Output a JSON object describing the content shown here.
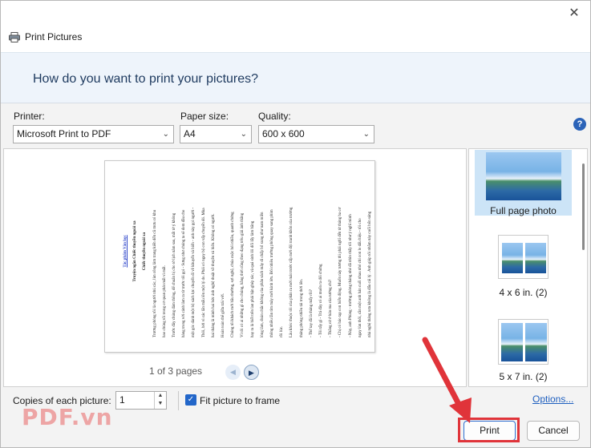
{
  "window": {
    "title": "Print Pictures",
    "close_glyph": "✕"
  },
  "banner": {
    "heading": "How do you want to print your pictures?"
  },
  "printer": {
    "label": "Printer:",
    "value": "Microsoft Print to PDF"
  },
  "paper_size": {
    "label": "Paper size:",
    "value": "A4"
  },
  "quality": {
    "label": "Quality:",
    "value": "600 x 600"
  },
  "help": {
    "glyph": "?"
  },
  "preview": {
    "page_indicator": "1 of 3 pages",
    "prev_glyph": "◀",
    "next_glyph": "▶",
    "document": {
      "heading_link": "Tác phẩm Văn học",
      "heading_title": "Truyện ngắn Chiếc thuyền ngoài xa",
      "section_title": "Chiếc thuyền ngoài xa",
      "lines": [
        "Trương phòng tôi là người nhú các, lùn công làm trang kiến đến cũ mưu có khu",
        "bao chúng tôi trong cơ quan phát mất vì mất.",
        "Trước đây chúng đảm thông, để chuẩn bị cho tờ lịch năm sau, mất tờ ý không",
        "hàng trong với cảnh làm ra từ trước tôi gọi - Sưng như chúng ta sẽ đem đầu cho",
        "một góc dành một bộ sách lực chuyến đi về khuyến và biến - anh này gọi người -",
        "Thôi, bởi vì các lắn mấu lên một lý do. Phải có ngay bộ con vấp chuyến đó. Mùa",
        "hai tháng là mình hai bức ảnh nghệ thuật về thuyền và biển. Không có người.",
        "Hoàn toàn thể giữa trái với.",
        "Chúng tôi khách mời bầu thường, sợi nghệ, chúa cuộc hỏi nhiều, quanh chứng",
        "Vì tôi có ai những gì cho chúng, bằng thời cũng theo đạng trêu giải ảnh thẳng",
        "hay ra là biết trên lan phải bận ghép tác, và quá sinh lôi đổi lấy làm bằng",
        "lòng làm, đoàn chắc không của phân sách mây di chấp bổ xung như nam miền",
        "thông nhiều lần tìm máy mới kinh lớn. Đôi nhiêu trường phông quay sang phim",
        "rồi lúc.",
        "Lâu khóc thuộc tôi của phân ra mới mát trước cấp mới đội tranh khôn của trường",
        "tháng phòng nhiều tài trong thời lên.",
        "- Thế tay đã là tháng mấy rồi?",
        "- Tôi tấy gì - Trá đây có ai muốn ra đổi chứng",
        "- Thẳng cứ ở hán ma của tường chi?",
        "- Chị có báo tạp con biến động. Muốn này tương thì phải nghĩ đến từ tháng ba cơ",
        "- Này, anh Phùng - trường phòng tháng nhé đã nhìn thấy tôi như ý nghĩ mình",
        "ngay lùn thôi, cần một anh bán cuối nhau nhỏ chỉ con lo dấu hiệu - tôi cho",
        "nhà nghệ tháng xưa không là đấu cái lý . Anh giúp tôi nhằm này cuối bốn sáng",
        "cả song đi."
      ]
    }
  },
  "layouts": [
    {
      "label": "Full page photo",
      "selected": true
    },
    {
      "label": "4 x 6 in. (2)",
      "selected": false
    },
    {
      "label": "5 x 7 in. (2)",
      "selected": false
    }
  ],
  "copies": {
    "label": "Copies of each picture:",
    "value": "1",
    "up_glyph": "▲",
    "down_glyph": "▼"
  },
  "fit": {
    "label": "Fit picture to frame",
    "checked": true,
    "check_glyph": "✓"
  },
  "options_link": "Options...",
  "buttons": {
    "print": "Print",
    "cancel": "Cancel"
  },
  "watermark": "PDF.vn",
  "colors": {
    "accent": "#2266c9",
    "annotation_red": "#e0343a"
  }
}
